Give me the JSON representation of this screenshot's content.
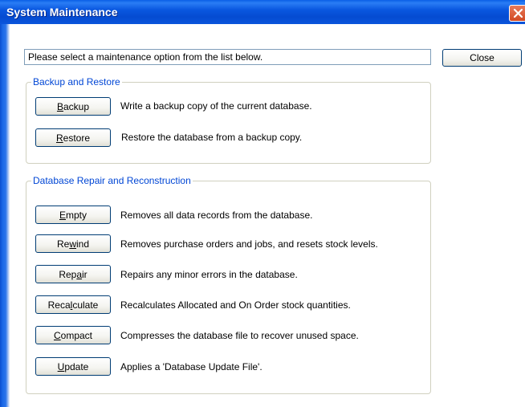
{
  "window": {
    "title": "System Maintenance"
  },
  "prompt": "Please select a maintenance option from the list below.",
  "close_button": "Close",
  "backup_group": {
    "legend": "Backup and Restore",
    "items": [
      {
        "pre": "",
        "key": "B",
        "post": "ackup",
        "desc": "Write a backup copy of the current database."
      },
      {
        "pre": "",
        "key": "R",
        "post": "estore",
        "desc": "Restore the database from a backup copy."
      }
    ]
  },
  "repair_group": {
    "legend": "Database Repair and Reconstruction",
    "items": [
      {
        "pre": "",
        "key": "E",
        "post": "mpty",
        "desc": "Removes all data records from the database."
      },
      {
        "pre": "Re",
        "key": "w",
        "post": "ind",
        "desc": "Removes purchase orders and jobs, and resets stock levels."
      },
      {
        "pre": "Rep",
        "key": "a",
        "post": "ir",
        "desc": "Repairs any minor errors in the database."
      },
      {
        "pre": "Reca",
        "key": "l",
        "post": "culate",
        "desc": "Recalculates Allocated and On Order stock quantities."
      },
      {
        "pre": "",
        "key": "C",
        "post": "ompact",
        "desc": "Compresses the database file to recover unused space."
      },
      {
        "pre": "",
        "key": "U",
        "post": "pdate",
        "desc": "Applies a 'Database Update File'."
      }
    ]
  }
}
